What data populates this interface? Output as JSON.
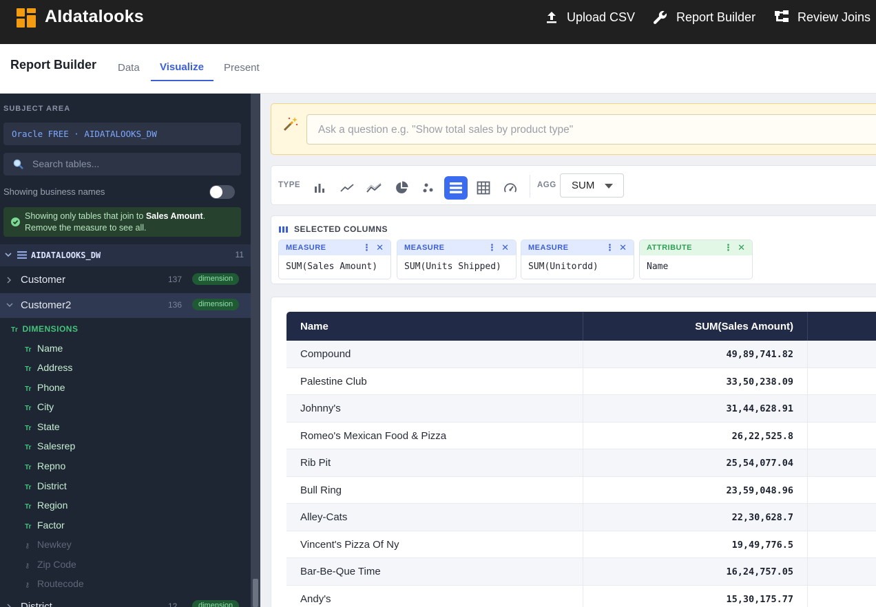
{
  "app": {
    "brand": "AIdatalooks",
    "nav": [
      {
        "label": "Upload CSV",
        "icon": "upload-icon"
      },
      {
        "label": "Report Builder",
        "icon": "wrench-icon"
      },
      {
        "label": "Review Joins",
        "icon": "joins-icon"
      }
    ]
  },
  "page": {
    "title": "Report Builder",
    "tabs": [
      {
        "label": "Data",
        "active": false
      },
      {
        "label": "Visualize",
        "active": true
      },
      {
        "label": "Present",
        "active": false
      }
    ]
  },
  "sidebar": {
    "section_label": "SUBJECT AREA",
    "subject_area": "Oracle FREE · AIDATALOOKS_DW",
    "search_placeholder": "Search tables...",
    "business_names_label": "Showing business names",
    "business_names_on": false,
    "alert": {
      "prefix": "Showing only tables that join to ",
      "measure": "Sales Amount",
      "suffix": ".",
      "line2": "Remove the measure to see all."
    },
    "schema": {
      "name": "AIDATALOOKS_DW",
      "count": "11"
    },
    "tables": [
      {
        "name": "Customer",
        "count": "137",
        "badge": "dimension",
        "expanded": false
      },
      {
        "name": "Customer2",
        "count": "136",
        "badge": "dimension",
        "expanded": true
      }
    ],
    "dimensions_label": "DIMENSIONS",
    "text_type_glyph": "Tr",
    "fields": [
      {
        "name": "Name",
        "kind": "text"
      },
      {
        "name": "Address",
        "kind": "text"
      },
      {
        "name": "Phone",
        "kind": "text"
      },
      {
        "name": "City",
        "kind": "text"
      },
      {
        "name": "State",
        "kind": "text"
      },
      {
        "name": "Salesrep",
        "kind": "text"
      },
      {
        "name": "Repno",
        "kind": "text"
      },
      {
        "name": "District",
        "kind": "text"
      },
      {
        "name": "Region",
        "kind": "text"
      },
      {
        "name": "Factor",
        "kind": "text"
      },
      {
        "name": "Newkey",
        "kind": "key"
      },
      {
        "name": "Zip Code",
        "kind": "key"
      },
      {
        "name": "Routecode",
        "kind": "key"
      }
    ],
    "next_table": {
      "name": "District",
      "count": "12",
      "badge": "dimension"
    }
  },
  "ask": {
    "placeholder": "Ask a question e.g. \"Show total sales by product type\""
  },
  "toolbar": {
    "type_label": "TYPE",
    "chart_types": [
      "bar-chart-icon",
      "line-chart-icon",
      "multi-line-chart-icon",
      "pie-chart-icon",
      "scatter-chart-icon",
      "table-view-icon",
      "pivot-grid-icon",
      "gauge-icon"
    ],
    "active_type": "table-view-icon",
    "agg_label": "AGG",
    "agg_value": "SUM"
  },
  "selected_columns": {
    "label": "SELECTED COLUMNS",
    "columns": [
      {
        "kind": "MEASURE",
        "value": "SUM(Sales Amount)"
      },
      {
        "kind": "MEASURE",
        "value": "SUM(Units Shipped)"
      },
      {
        "kind": "MEASURE",
        "value": "SUM(Unitordd)"
      },
      {
        "kind": "ATTRIBUTE",
        "value": "Name"
      }
    ]
  },
  "results": {
    "headers": [
      "Name",
      "SUM(Sales Amount)"
    ],
    "rows": [
      [
        "Compound",
        "49,89,741.82"
      ],
      [
        "Palestine Club",
        "33,50,238.09"
      ],
      [
        "Johnny's",
        "31,44,628.91"
      ],
      [
        "Romeo's Mexican Food & Pizza",
        "26,22,525.8"
      ],
      [
        "Rib Pit",
        "25,54,077.04"
      ],
      [
        "Bull Ring",
        "23,59,048.96"
      ],
      [
        "Alley-Cats",
        "22,30,628.7"
      ],
      [
        "Vincent's Pizza Of Ny",
        "19,49,776.5"
      ],
      [
        "Bar-Be-Que Time",
        "16,24,757.05"
      ],
      [
        "Andy's",
        "15,30,175.77"
      ]
    ]
  },
  "colors": {
    "accent": "#3b6cf0",
    "topbar": "#202020",
    "sidebar": "#1e2533",
    "dimension_green": "#44c47a",
    "table_header": "#212b48"
  }
}
